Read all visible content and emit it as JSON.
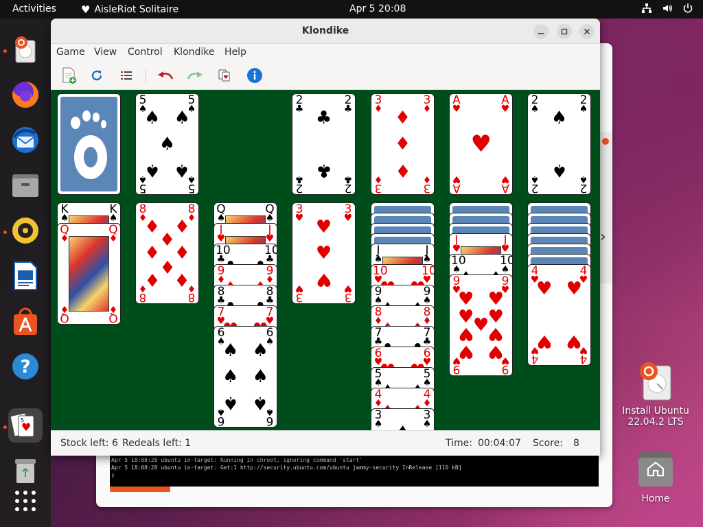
{
  "topbar": {
    "activities": "Activities",
    "app_name": "AisleRiot Solitaire",
    "clock": "Apr 5  20:08"
  },
  "window": {
    "title": "Klondike",
    "menu": [
      "Game",
      "View",
      "Control",
      "Klondike",
      "Help"
    ]
  },
  "toolbar": {
    "icons": [
      "new-game-icon",
      "restart-icon",
      "select-game-icon",
      "undo-icon",
      "redo-icon",
      "hint-icon",
      "info-icon"
    ]
  },
  "status": {
    "stock_left": "Stock left: 6",
    "redeals_left": "Redeals left: 1",
    "time_label": "Time:",
    "time_value": "00:04:07",
    "score_label": "Score:",
    "score_value": "8"
  },
  "game": {
    "stock": "back",
    "waste": {
      "rank": "5",
      "suit": "spades"
    },
    "foundations": [
      {
        "rank": "2",
        "suit": "clubs"
      },
      {
        "rank": "3",
        "suit": "diamonds"
      },
      {
        "rank": "A",
        "suit": "hearts"
      },
      {
        "rank": "2",
        "suit": "spades"
      }
    ],
    "tableau": [
      {
        "face_down": 0,
        "face_up": [
          {
            "rank": "K",
            "suit": "spades"
          },
          {
            "rank": "Q",
            "suit": "diamonds"
          }
        ]
      },
      {
        "face_down": 0,
        "face_up": [
          {
            "rank": "8",
            "suit": "diamonds"
          }
        ]
      },
      {
        "face_down": 0,
        "face_up": [
          {
            "rank": "Q",
            "suit": "spades"
          },
          {
            "rank": "J",
            "suit": "hearts"
          },
          {
            "rank": "10",
            "suit": "clubs"
          },
          {
            "rank": "9",
            "suit": "diamonds"
          },
          {
            "rank": "8",
            "suit": "clubs"
          },
          {
            "rank": "7",
            "suit": "hearts"
          },
          {
            "rank": "6",
            "suit": "spades"
          }
        ]
      },
      {
        "face_down": 0,
        "face_up": [
          {
            "rank": "3",
            "suit": "hearts"
          }
        ]
      },
      {
        "face_down": 4,
        "face_up": [
          {
            "rank": "J",
            "suit": "spades"
          },
          {
            "rank": "10",
            "suit": "hearts"
          },
          {
            "rank": "9",
            "suit": "spades"
          },
          {
            "rank": "8",
            "suit": "diamonds"
          },
          {
            "rank": "7",
            "suit": "clubs"
          },
          {
            "rank": "6",
            "suit": "hearts"
          },
          {
            "rank": "5",
            "suit": "spades"
          },
          {
            "rank": "4",
            "suit": "diamonds"
          },
          {
            "rank": "3",
            "suit": "spades"
          }
        ]
      },
      {
        "face_down": 3,
        "face_up": [
          {
            "rank": "J",
            "suit": "hearts"
          },
          {
            "rank": "10",
            "suit": "spades"
          },
          {
            "rank": "9",
            "suit": "hearts"
          }
        ]
      },
      {
        "face_down": 6,
        "face_up": [
          {
            "rank": "4",
            "suit": "hearts"
          }
        ]
      }
    ]
  },
  "background_window": {
    "terminal_lines": [
      "Apr  5 18:08:28 ubuntu in-target: Running in chroot, ignoring command 'start'",
      "Apr  5 18:08:28 ubuntu in-target: Get:1 http://security.ubuntu.com/ubuntu jammy-security InRelease [110 kB]"
    ]
  },
  "desktop": {
    "install_label_1": "Install Ubuntu",
    "install_label_2": "22.04.2 LTS",
    "home_label": "Home"
  },
  "colors": {
    "felt": "#004d1c",
    "ubuntu_orange": "#e95420",
    "card_red": "#e10000"
  }
}
